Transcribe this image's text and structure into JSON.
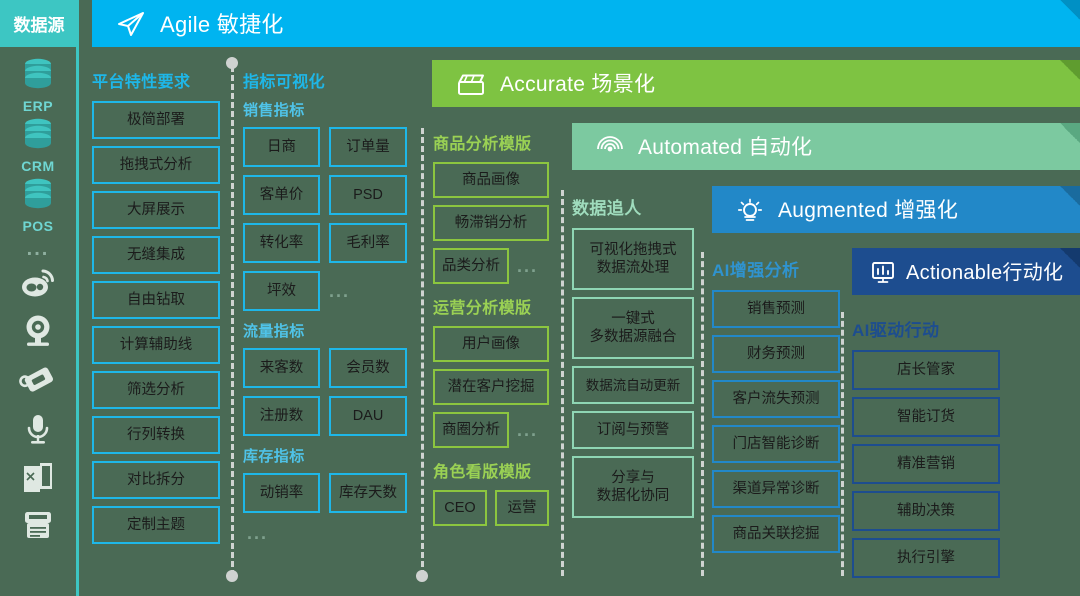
{
  "sidebar": {
    "title": "数据源",
    "items": [
      {
        "icon": "database-icon",
        "label": "ERP"
      },
      {
        "icon": "database-icon",
        "label": "CRM"
      },
      {
        "icon": "database-icon",
        "label": "POS"
      },
      {
        "icon": "ellipsis-icon",
        "label": "..."
      },
      {
        "icon": "weibo-icon",
        "label": ""
      },
      {
        "icon": "webcam-icon",
        "label": ""
      },
      {
        "icon": "price-tag-icon",
        "label": ""
      },
      {
        "icon": "microphone-icon",
        "label": ""
      },
      {
        "icon": "book-icon",
        "label": ""
      },
      {
        "icon": "document-icon",
        "label": ""
      }
    ]
  },
  "banners": [
    {
      "id": "agile",
      "icon": "paper-plane-icon",
      "text": "Agile 敏捷化",
      "color": "#00b4f0",
      "fold": "#0090c4"
    },
    {
      "id": "accurate",
      "icon": "clapperboard-icon",
      "text": "Accurate 场景化",
      "color": "#7ec342",
      "fold": "#5f9c2f"
    },
    {
      "id": "automated",
      "icon": "radar-icon",
      "text": "Automated 自动化",
      "color": "#7cc9a0",
      "fold": "#5aa881"
    },
    {
      "id": "augmented",
      "icon": "lightbulb-icon",
      "text": "Augmented 增强化",
      "color": "#2288c8",
      "fold": "#1a6b9e"
    },
    {
      "id": "actionable",
      "icon": "chart-board-icon",
      "text": "Actionable行动化",
      "color": "#1d4d8f",
      "fold": "#143a6e"
    }
  ],
  "columns": [
    {
      "id": "platform",
      "title": "平台特性要求",
      "title_color": "#1eb7e8",
      "chip_border": "#1eb7e8",
      "groups": [
        {
          "label": "",
          "items": [
            "极简部署",
            "拖拽式分析",
            "大屏展示",
            "无缝集成",
            "自由钻取",
            "计算辅助线",
            "筛选分析",
            "行列转换",
            "对比拆分",
            "定制主题"
          ]
        }
      ]
    },
    {
      "id": "metrics",
      "title": "指标可视化",
      "title_color": "#1eb7e8",
      "chip_border": "#1eb7e8",
      "groups": [
        {
          "label": "销售指标",
          "items": [
            "日商",
            "订单量",
            "客单价",
            "PSD",
            "转化率",
            "毛利率",
            "坪效"
          ],
          "trailing_dots": "..."
        },
        {
          "label": "流量指标",
          "items": [
            "来客数",
            "会员数",
            "注册数",
            "DAU"
          ]
        },
        {
          "label": "库存指标",
          "items": [
            "动销率",
            "库存天数"
          ],
          "trailing_dots": "..."
        }
      ]
    },
    {
      "id": "templates",
      "title": "",
      "title_color": "#8cc63f",
      "chip_border": "#8cc63f",
      "groups": [
        {
          "label": "商品分析模版",
          "items": [
            "商品画像",
            "畅滞销分析",
            "品类分析"
          ],
          "trailing_dots": "..."
        },
        {
          "label": "运营分析模版",
          "items": [
            "用户画像",
            "潜在客户挖掘",
            "商圈分析"
          ],
          "trailing_dots": "..."
        },
        {
          "label": "角色看版模版",
          "items": [
            "CEO",
            "运营"
          ]
        }
      ]
    },
    {
      "id": "datachase",
      "title": "数据追人",
      "title_color": "#8fd6b4",
      "chip_border": "#8fd6b4",
      "groups": [
        {
          "label": "",
          "items": [
            "可视化拖拽式\n数据流处理",
            "一键式\n多数据源融合",
            "数据流自动更新",
            "订阅与预警",
            "分享与\n数据化协同"
          ]
        }
      ]
    },
    {
      "id": "aianalysis",
      "title": "AI增强分析",
      "title_color": "#2288c8",
      "chip_border": "#2288c8",
      "groups": [
        {
          "label": "",
          "items": [
            "销售预测",
            "财务预测",
            "客户流失预测",
            "门店智能诊断",
            "渠道异常诊断",
            "商品关联挖掘"
          ]
        }
      ]
    },
    {
      "id": "aiaction",
      "title": "AI驱动行动",
      "title_color": "#1d4d8f",
      "chip_border": "#1d4d8f",
      "groups": [
        {
          "label": "",
          "items": [
            "店长管家",
            "智能订货",
            "精准营销",
            "辅助决策",
            "执行引擎"
          ]
        }
      ]
    }
  ]
}
